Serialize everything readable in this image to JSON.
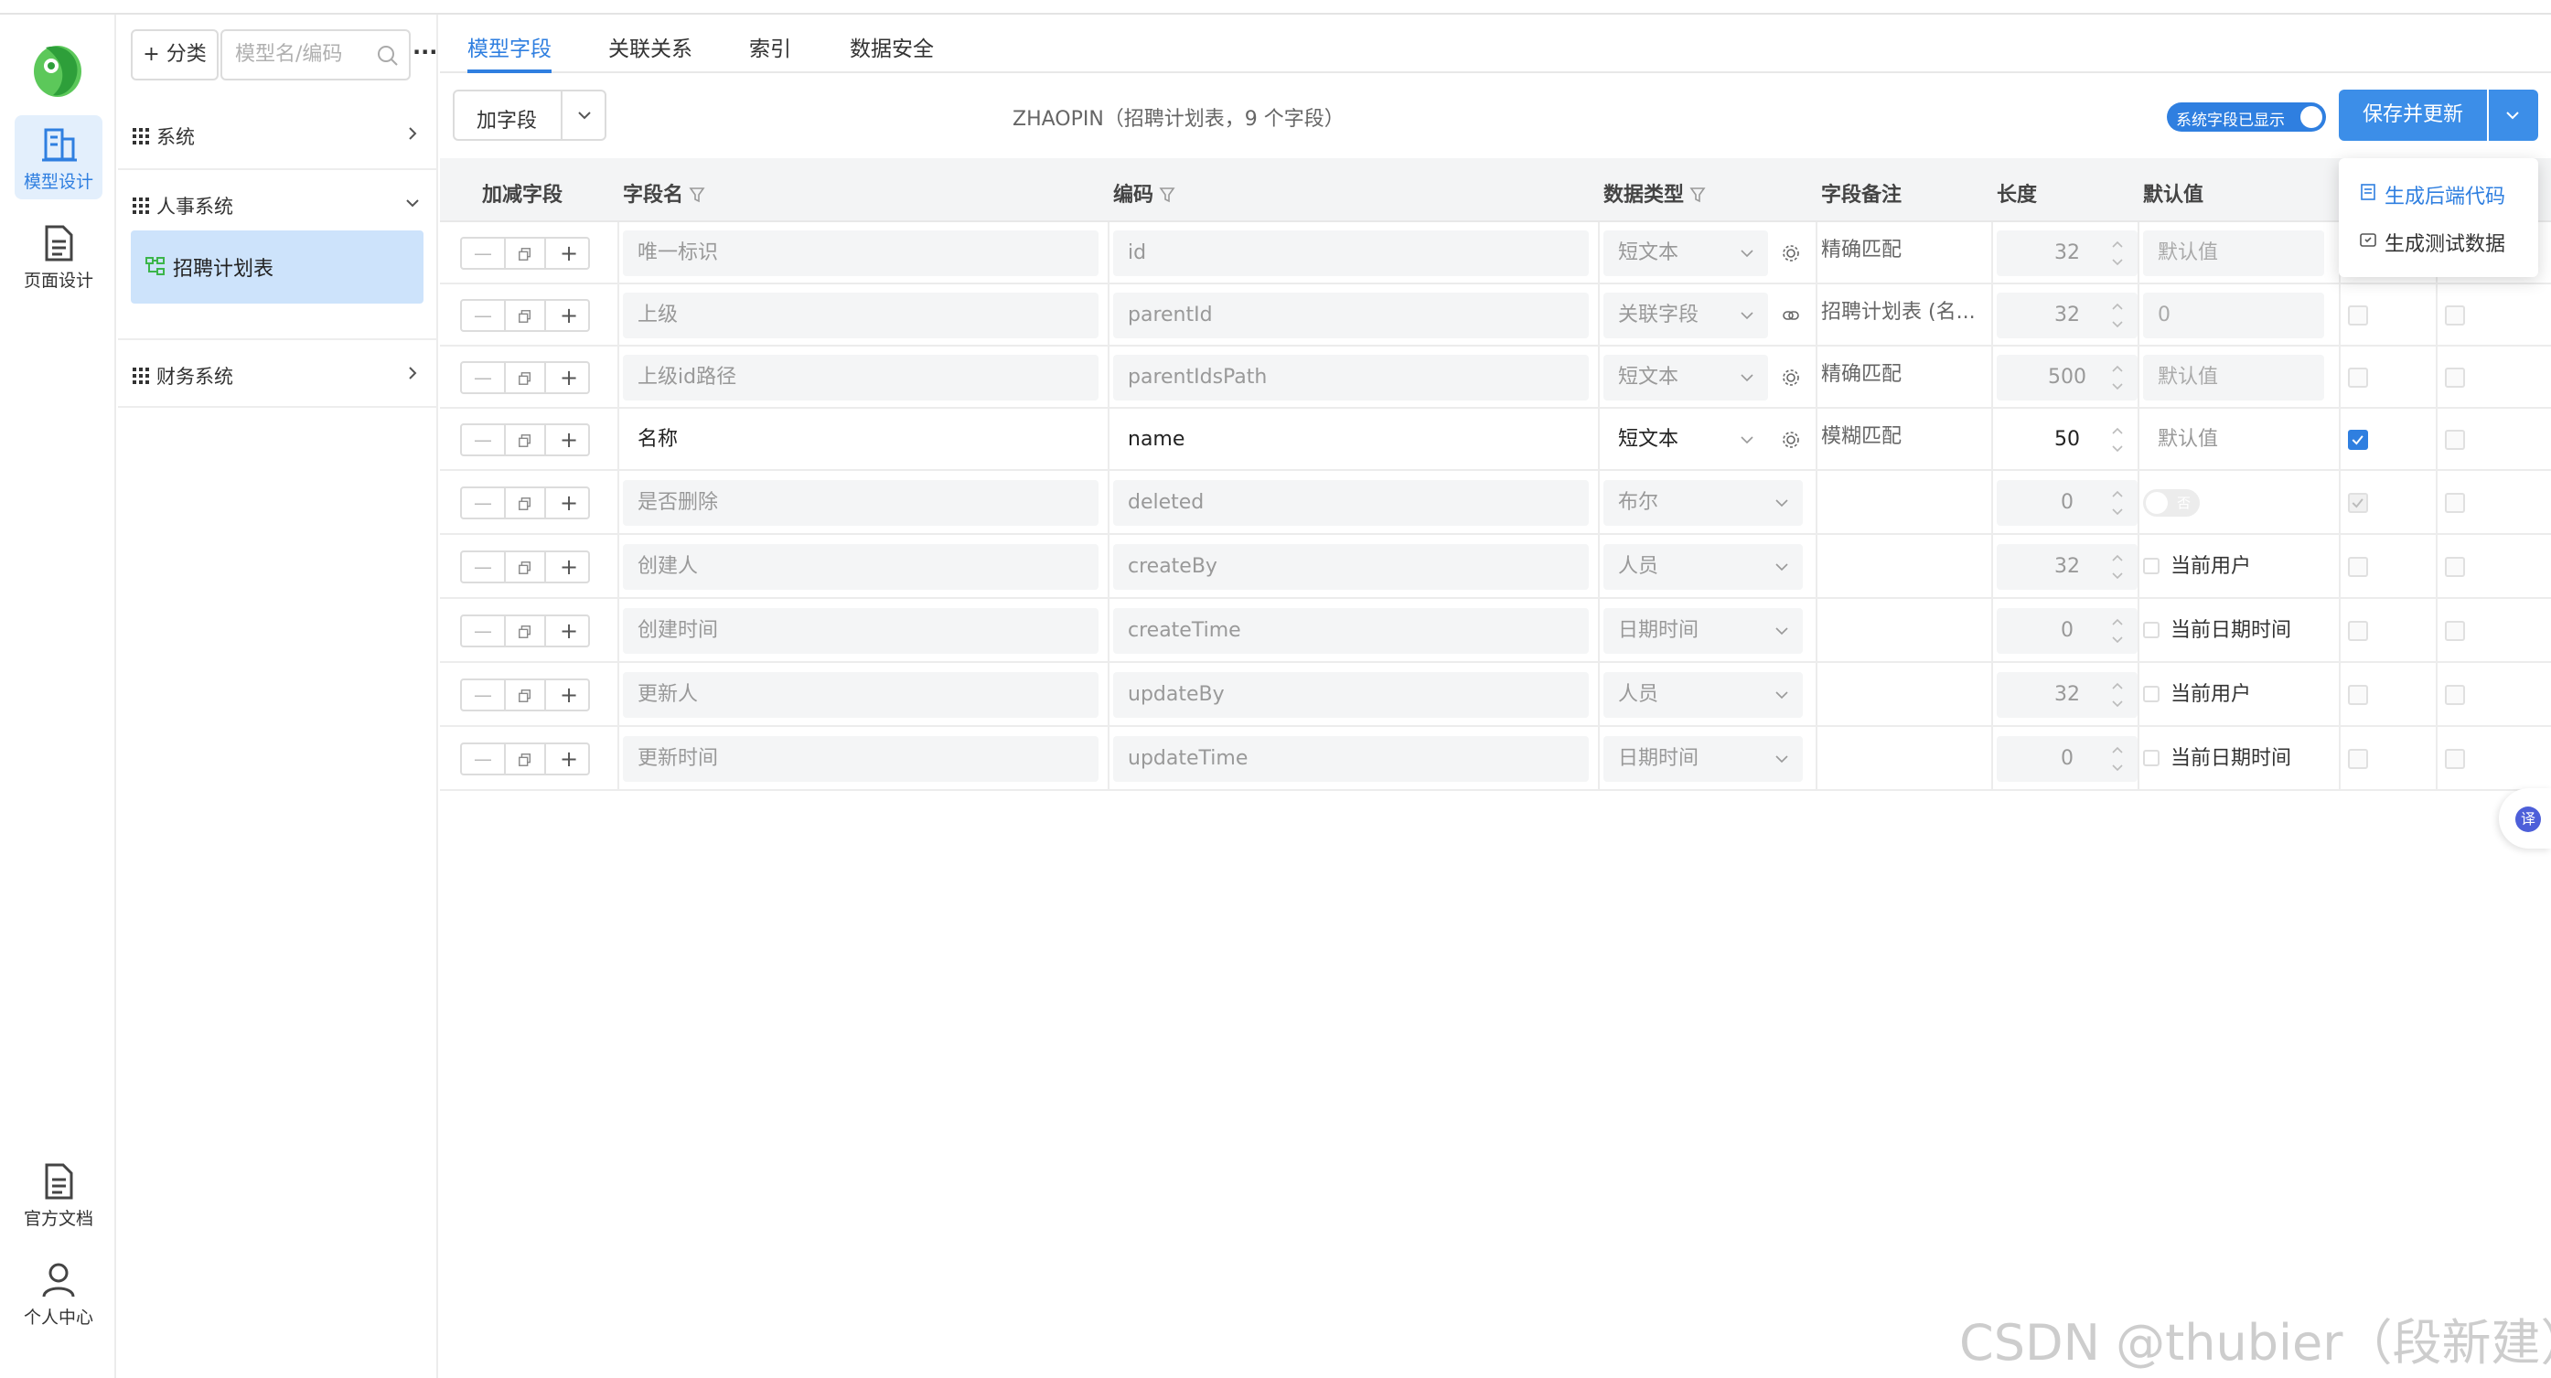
{
  "rail": {
    "items": [
      {
        "label": "模型设计",
        "icon": "building-icon",
        "active": true
      },
      {
        "label": "页面设计",
        "icon": "document-icon",
        "active": false
      }
    ],
    "bottom": [
      {
        "label": "官方文档",
        "icon": "document-icon"
      },
      {
        "label": "个人中心",
        "icon": "user-icon"
      }
    ]
  },
  "tree": {
    "add_category_label": "+ 分类",
    "search_placeholder": "模型名/编码",
    "groups": [
      {
        "label": "系统",
        "expanded": false
      },
      {
        "label": "人事系统",
        "expanded": true
      },
      {
        "label": "财务系统",
        "expanded": false
      }
    ],
    "selected_leaf": "招聘计划表"
  },
  "tabs": [
    "模型字段",
    "关联关系",
    "索引",
    "数据安全"
  ],
  "active_tab": "模型字段",
  "toolbar": {
    "add_field_label": "加字段",
    "model_title": "ZHAOPIN（招聘计划表，9 个字段）",
    "sys_toggle_label": "系统字段已显示",
    "save_label": "保存并更新"
  },
  "dropdown": {
    "items": [
      "生成后端代码",
      "生成测试数据"
    ]
  },
  "table": {
    "headers": [
      "加减字段",
      "字段名",
      "编码",
      "数据类型",
      "字段备注",
      "长度",
      "默认值"
    ],
    "rows": [
      {
        "name": "唯一标识",
        "code": "id",
        "type": "短文本",
        "remark": "精确匹配",
        "length": "32",
        "default": "默认值",
        "default_kind": "box",
        "editable": false,
        "gear": "gear"
      },
      {
        "name": "上级",
        "code": "parentId",
        "type": "关联字段",
        "remark": "招聘计划表 (名...",
        "length": "32",
        "default": "0",
        "default_kind": "box",
        "editable": false,
        "gear": "link"
      },
      {
        "name": "上级id路径",
        "code": "parentIdsPath",
        "type": "短文本",
        "remark": "精确匹配",
        "length": "500",
        "default": "默认值",
        "default_kind": "box",
        "editable": false,
        "gear": "gear"
      },
      {
        "name": "名称",
        "code": "name",
        "type": "短文本",
        "remark": "模糊匹配",
        "length": "50",
        "default": "默认值",
        "default_kind": "box",
        "editable": true,
        "gear": "gear"
      },
      {
        "name": "是否删除",
        "code": "deleted",
        "type": "布尔",
        "remark": "",
        "length": "0",
        "default": "否",
        "default_kind": "toggle",
        "editable": false,
        "gear": ""
      },
      {
        "name": "创建人",
        "code": "createBy",
        "type": "人员",
        "remark": "",
        "length": "32",
        "default": "当前用户",
        "default_kind": "check",
        "editable": false,
        "gear": ""
      },
      {
        "name": "创建时间",
        "code": "createTime",
        "type": "日期时间",
        "remark": "",
        "length": "0",
        "default": "当前日期时间",
        "default_kind": "check",
        "editable": false,
        "gear": ""
      },
      {
        "name": "更新人",
        "code": "updateBy",
        "type": "人员",
        "remark": "",
        "length": "32",
        "default": "当前用户",
        "default_kind": "check",
        "editable": false,
        "gear": ""
      },
      {
        "name": "更新时间",
        "code": "updateTime",
        "type": "日期时间",
        "remark": "",
        "length": "0",
        "default": "当前日期时间",
        "default_kind": "check",
        "editable": false,
        "gear": ""
      }
    ]
  },
  "translate_label": "译",
  "watermark": "CSDN @thubier（段新建）",
  "colors": {
    "accent": "#2f7fe0",
    "selected_bg": "#cde3fb",
    "header_bg": "#f3f4f5"
  }
}
